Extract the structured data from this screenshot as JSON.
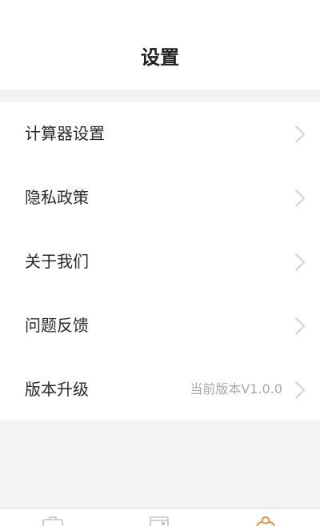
{
  "header": {
    "title": "设置"
  },
  "settings": {
    "items": [
      {
        "label": "计算器设置",
        "value": ""
      },
      {
        "label": "隐私政策",
        "value": ""
      },
      {
        "label": "关于我们",
        "value": ""
      },
      {
        "label": "问题反馈",
        "value": ""
      },
      {
        "label": "版本升级",
        "value": "当前版本V1.0.0"
      }
    ],
    "chevron_icon": "chevron-right-icon"
  },
  "tabbar": {
    "tabs": [
      {
        "icon": "briefcase-icon",
        "active": false
      },
      {
        "icon": "calendar-icon",
        "active": false
      },
      {
        "icon": "profile-icon",
        "active": true
      }
    ],
    "active_color": "#e98b27",
    "inactive_color": "#c2c2c2"
  },
  "colors": {
    "background": "#f3f3f5",
    "card": "#ffffff",
    "text": "#2a2a2a",
    "secondary_text": "#a8a8a8"
  }
}
